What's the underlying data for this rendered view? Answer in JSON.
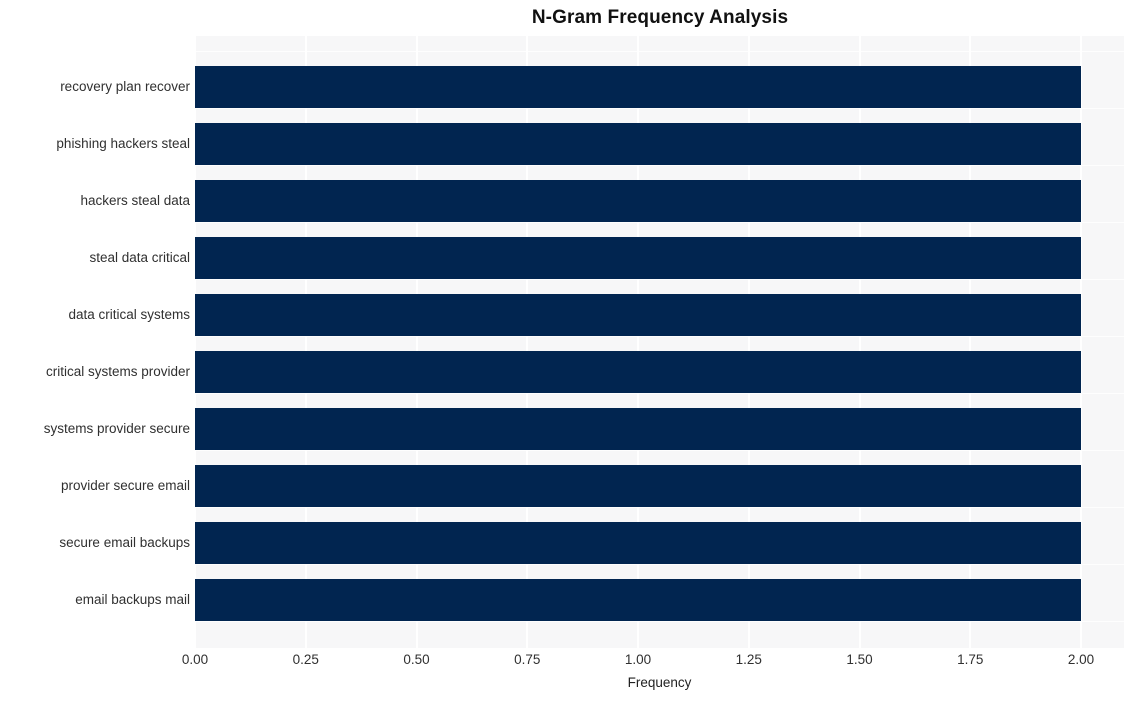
{
  "chart_data": {
    "type": "bar",
    "orientation": "horizontal",
    "title": "N-Gram Frequency Analysis",
    "xlabel": "Frequency",
    "ylabel": "",
    "categories": [
      "recovery plan recover",
      "phishing hackers steal",
      "hackers steal data",
      "steal data critical",
      "data critical systems",
      "critical systems provider",
      "systems provider secure",
      "provider secure email",
      "secure email backups",
      "email backups mail"
    ],
    "values": [
      2,
      2,
      2,
      2,
      2,
      2,
      2,
      2,
      2,
      2
    ],
    "xlim": [
      0,
      2
    ],
    "xticks": [
      "0.00",
      "0.25",
      "0.50",
      "0.75",
      "1.00",
      "1.25",
      "1.50",
      "1.75",
      "2.00"
    ],
    "xtick_values": [
      0,
      0.25,
      0.5,
      0.75,
      1.0,
      1.25,
      1.5,
      1.75,
      2.0
    ],
    "grid": true,
    "legend": null,
    "bar_color": "#012550",
    "plot_background": "#f7f7f8",
    "figure_background": "#ffffff",
    "gridline_color": "#ffffff",
    "text_color": "#303030",
    "title_color": "#111111"
  }
}
